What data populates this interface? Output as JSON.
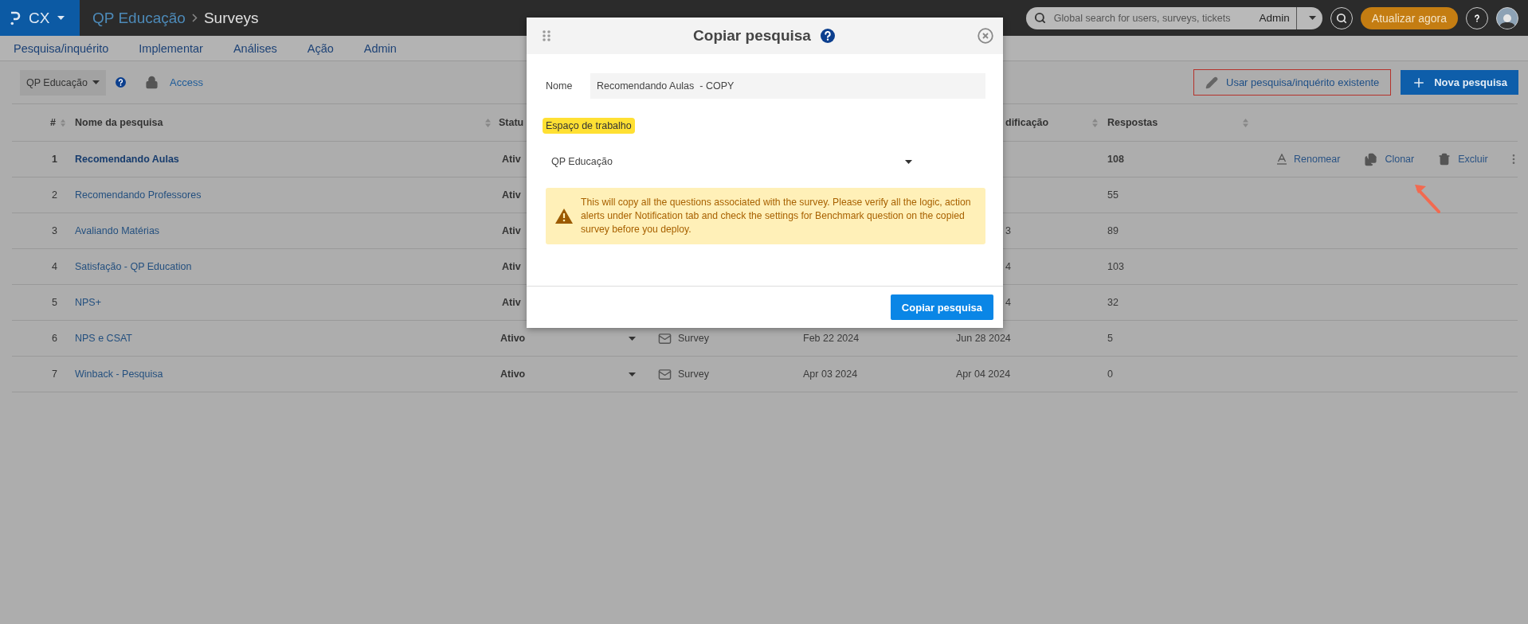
{
  "topbar": {
    "product": "CX",
    "breadcrumb": [
      "QP Educação",
      "Surveys"
    ],
    "search": {
      "placeholder": "Global search for users, surveys, tickets",
      "scope": "Admin"
    },
    "update_button": "Atualizar agora"
  },
  "nav": [
    "Pesquisa/inquérito",
    "Implementar",
    "Análises",
    "Ação",
    "Admin"
  ],
  "toolbar": {
    "workspace": "QP Educação",
    "access_link": "Access",
    "use_existing_button": "Usar pesquisa/inquérito existente",
    "new_button": "Nova pesquisa"
  },
  "table": {
    "columns": {
      "number": "#",
      "name": "Nome da pesquisa",
      "status": "Statu",
      "modified": "dificação",
      "responses": "Respostas"
    },
    "rows": [
      {
        "number": "1",
        "name": "Recomendando Aulas",
        "status": "Ativ",
        "modified": "",
        "responses": "108",
        "selected": true,
        "actions": [
          {
            "kind": "rename",
            "label": "Renomear"
          },
          {
            "kind": "clone",
            "label": "Clonar"
          },
          {
            "kind": "delete",
            "label": "Excluir"
          }
        ]
      },
      {
        "number": "2",
        "name": "Recomendando Professores",
        "status": "Ativ",
        "responses": "55",
        "selected": false
      },
      {
        "number": "3",
        "name": "Avaliando Matérias",
        "status": "Ativ",
        "modified": "3",
        "responses": "89",
        "selected": false
      },
      {
        "number": "4",
        "name": "Satisfação - QP Education",
        "status": "Ativ",
        "modified": "4",
        "responses": "103",
        "selected": false
      },
      {
        "number": "5",
        "name": "NPS+",
        "status": "Ativ",
        "modified": "4",
        "responses": "32",
        "selected": false
      },
      {
        "number": "6",
        "name": "NPS e CSAT",
        "status": "Ativo",
        "type": "Survey",
        "created": "Feb 22 2024",
        "modified": "Jun 28 2024",
        "responses": "5",
        "selected": false
      },
      {
        "number": "7",
        "name": "Winback - Pesquisa",
        "status": "Ativo",
        "type": "Survey",
        "created": "Apr 03 2024",
        "modified": "Apr 04 2024",
        "responses": "0",
        "selected": false
      }
    ]
  },
  "dialog": {
    "title": "Copiar pesquisa",
    "name_label": "Nome",
    "name_value": "Recomendando Aulas  - COPY",
    "workspace_label": "Espaço de trabalho",
    "workspace_value": "QP Educação",
    "warning": "This will copy all the questions associated with the survey. Please verify all the logic, action alerts under Notification tab and check the settings for Benchmark question on the copied survey before you deploy.",
    "submit_button": "Copiar pesquisa"
  }
}
